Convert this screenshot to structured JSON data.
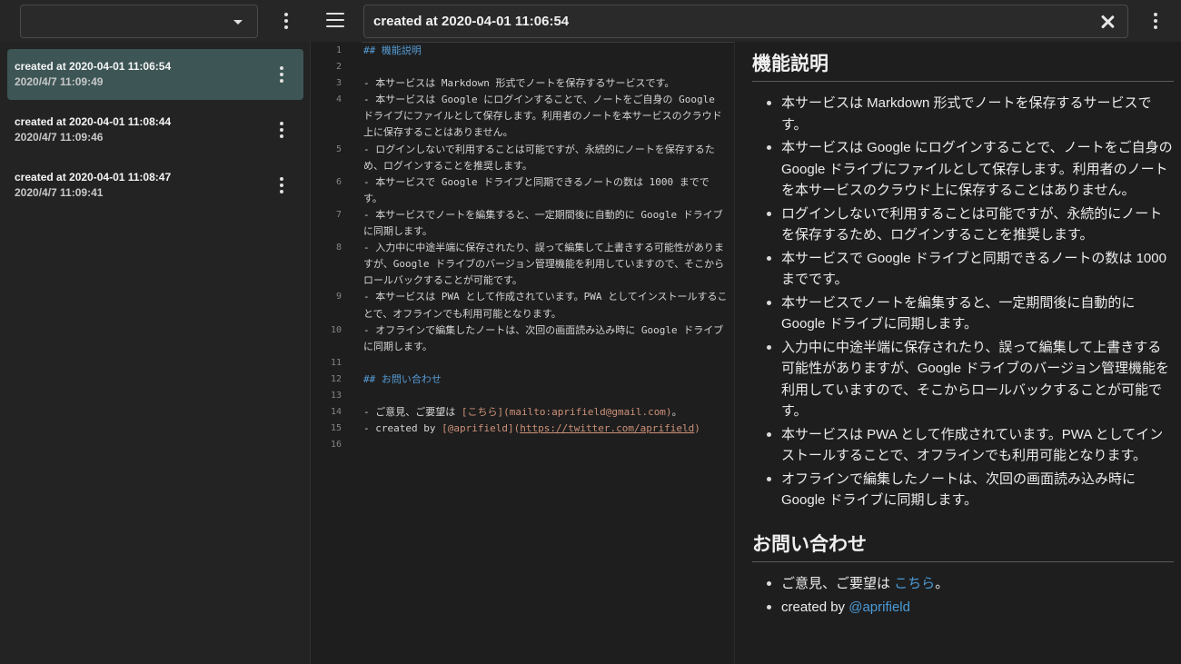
{
  "note_title": "created at 2020-04-01 11:06:54",
  "sidebar": {
    "items": [
      {
        "title": "created at 2020-04-01 11:06:54",
        "date": "2020/4/7 11:09:49",
        "active": true
      },
      {
        "title": "created at 2020-04-01 11:08:44",
        "date": "2020/4/7 11:09:46",
        "active": false
      },
      {
        "title": "created at 2020-04-01 11:08:47",
        "date": "2020/4/7 11:09:41",
        "active": false
      }
    ]
  },
  "editor": {
    "lines": [
      {
        "n": "1",
        "t": "## 機能説明"
      },
      {
        "n": "2",
        "t": ""
      },
      {
        "n": "3",
        "t": "- 本サービスは Markdown 形式でノートを保存するサービスです。"
      },
      {
        "n": "4",
        "t": "- 本サービスは Google にログインすることで、ノートをご自身の Google ドライブにファイルとして保存します。利用者のノートを本サービスのクラウド上に保存することはありません。"
      },
      {
        "n": "5",
        "t": "- ログインしないで利用することは可能ですが、永続的にノートを保存するため、ログインすることを推奨します。"
      },
      {
        "n": "6",
        "t": "- 本サービスで Google ドライブと同期できるノートの数は 1000 までです。"
      },
      {
        "n": "7",
        "t": "- 本サービスでノートを編集すると、一定期間後に自動的に Google ドライブに同期します。"
      },
      {
        "n": "8",
        "t": "- 入力中に中途半端に保存されたり、誤って編集して上書きする可能性がありますが、Google ドライブのバージョン管理機能を利用していますので、そこからロールバックすることが可能です。"
      },
      {
        "n": "9",
        "t": "- 本サービスは PWA として作成されています。PWA としてインストールすることで、オフラインでも利用可能となります。"
      },
      {
        "n": "10",
        "t": "- オフラインで編集したノートは、次回の画面読み込み時に Google ドライブに同期します。"
      },
      {
        "n": "11",
        "t": ""
      },
      {
        "n": "12",
        "t": "## お問い合わせ"
      },
      {
        "n": "13",
        "t": ""
      },
      {
        "n": "14",
        "t": "- ご意見、ご要望は [こちら](mailto:aprifield@gmail.com)。"
      },
      {
        "n": "15",
        "t": "- created by [@aprifield](https://twitter.com/aprifield)"
      },
      {
        "n": "16",
        "t": ""
      }
    ],
    "line14": {
      "prefix": "- ご意見、ご要望は ",
      "link_text": "[こちら]",
      "link_url": "(mailto:aprifield@gmail.com)",
      "suffix": "。"
    },
    "line15": {
      "prefix": "- created by ",
      "link_text": "[@aprifield]",
      "link_url_open": "(",
      "link_url": "https://twitter.com/aprifield",
      "link_url_close": ")"
    }
  },
  "preview": {
    "heading1": "機能説明",
    "items1": [
      "本サービスは Markdown 形式でノートを保存するサービスです。",
      "本サービスは Google にログインすることで、ノートをご自身の Google ドライブにファイルとして保存します。利用者のノートを本サービスのクラウド上に保存することはありません。",
      "ログインしないで利用することは可能ですが、永続的にノートを保存するため、ログインすることを推奨します。",
      "本サービスで Google ドライブと同期できるノートの数は 1000 までです。",
      "本サービスでノートを編集すると、一定期間後に自動的に Google ドライブに同期します。",
      "入力中に中途半端に保存されたり、誤って編集して上書きする可能性がありますが、Google ドライブのバージョン管理機能を利用していますので、そこからロールバックすることが可能です。",
      "本サービスは PWA として作成されています。PWA としてインストールすることで、オフラインでも利用可能となります。",
      "オフラインで編集したノートは、次回の画面読み込み時に Google ドライブに同期します。"
    ],
    "heading2": "お問い合わせ",
    "contact": {
      "prefix": "ご意見、ご要望は ",
      "link": "こちら",
      "suffix": "。"
    },
    "credit": {
      "prefix": "created by ",
      "link": "@aprifield"
    }
  },
  "colors": {
    "active_item_bg": "#3d5555",
    "link": "#4b9bd8",
    "md_heading": "#569cd6",
    "md_link": "#ce9178"
  }
}
